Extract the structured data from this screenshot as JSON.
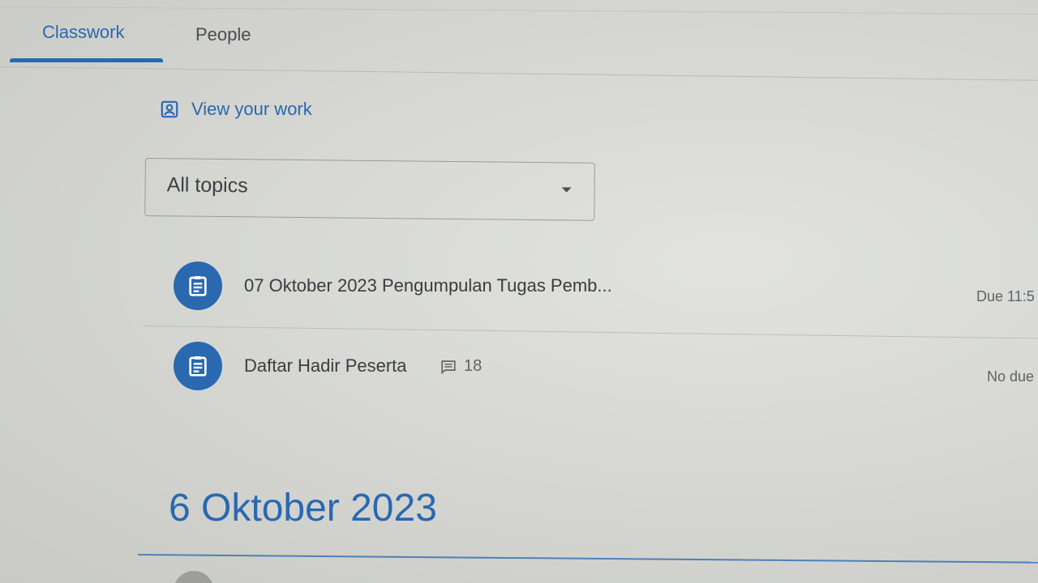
{
  "tabs": {
    "classwork": "Classwork",
    "people": "People"
  },
  "view_work": {
    "label": "View your work",
    "icon": "assignment-ind-icon"
  },
  "topic_filter": {
    "selected": "All topics",
    "icon": "dropdown-arrow-icon"
  },
  "assignments": [
    {
      "title": "07 Oktober 2023 Pengumpulan Tugas Pemb...",
      "due": "Due 11:5",
      "icon": "assignment-icon"
    },
    {
      "title": "Daftar Hadir Peserta",
      "comment_count": "18",
      "due": "No due",
      "icon": "assignment-icon"
    }
  ],
  "section": {
    "title": "6 Oktober 2023"
  },
  "colors": {
    "accent": "#2a68b0",
    "text": "#3a3d40",
    "muted": "#5f6368"
  }
}
